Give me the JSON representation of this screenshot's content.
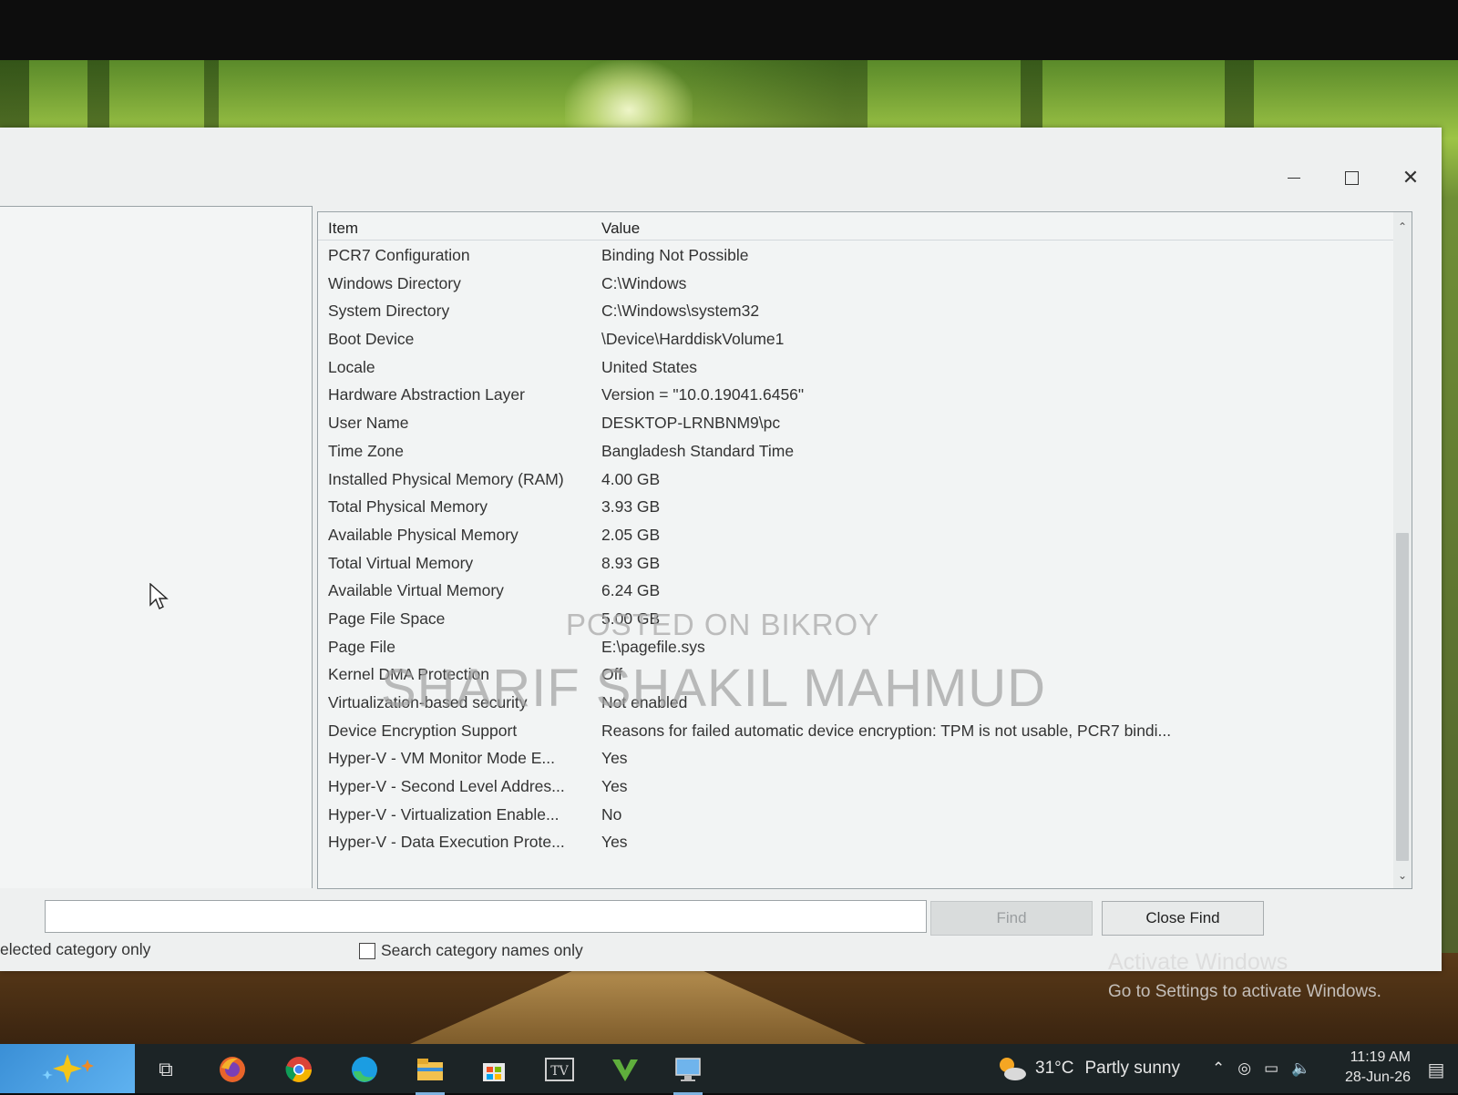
{
  "window": {
    "controls": {
      "minimize_icon": "minimize-icon",
      "maximize_icon": "maximize-icon",
      "close_icon": "close-icon"
    }
  },
  "list": {
    "header": {
      "item": "Item",
      "value": "Value"
    },
    "rows": [
      {
        "item": "PCR7 Configuration",
        "value": "Binding Not Possible"
      },
      {
        "item": "Windows Directory",
        "value": "C:\\Windows"
      },
      {
        "item": "System Directory",
        "value": "C:\\Windows\\system32"
      },
      {
        "item": "Boot Device",
        "value": "\\Device\\HarddiskVolume1"
      },
      {
        "item": "Locale",
        "value": "United States"
      },
      {
        "item": "Hardware Abstraction Layer",
        "value": "Version = \"10.0.19041.6456\""
      },
      {
        "item": "User Name",
        "value": "DESKTOP-LRNBNM9\\pc"
      },
      {
        "item": "Time Zone",
        "value": "Bangladesh Standard Time"
      },
      {
        "item": "Installed Physical Memory (RAM)",
        "value": "4.00 GB"
      },
      {
        "item": "Total Physical Memory",
        "value": "3.93 GB"
      },
      {
        "item": "Available Physical Memory",
        "value": "2.05 GB"
      },
      {
        "item": "Total Virtual Memory",
        "value": "8.93 GB"
      },
      {
        "item": "Available Virtual Memory",
        "value": "6.24 GB"
      },
      {
        "item": "Page File Space",
        "value": "5.00 GB"
      },
      {
        "item": "Page File",
        "value": "E:\\pagefile.sys"
      },
      {
        "item": "Kernel DMA Protection",
        "value": "Off"
      },
      {
        "item": "Virtualization-based security",
        "value": "Not enabled"
      },
      {
        "item": "Device Encryption Support",
        "value": "Reasons for failed automatic device encryption: TPM is not usable, PCR7 bindi..."
      },
      {
        "item": "Hyper-V - VM Monitor Mode E...",
        "value": "Yes"
      },
      {
        "item": "Hyper-V - Second Level Addres...",
        "value": "Yes"
      },
      {
        "item": "Hyper-V - Virtualization Enable...",
        "value": "No"
      },
      {
        "item": "Hyper-V - Data Execution Prote...",
        "value": "Yes"
      }
    ]
  },
  "find": {
    "input_value": "",
    "find_label": "Find",
    "close_find_label": "Close Find",
    "selected_category_label": "elected category only",
    "search_names_label": "Search category names only",
    "search_names_checked": false
  },
  "watermarks": {
    "posted": "POSTED ON BIKROY",
    "name": "SHARIF SHAKIL MAHMUD"
  },
  "activation": {
    "title": "Activate Windows",
    "subtitle": "Go to Settings to activate Windows."
  },
  "taskbar": {
    "apps": [
      "task-view-icon",
      "firefox-icon",
      "chrome-icon",
      "edge-icon",
      "file-explorer-icon",
      "store-icon",
      "tv-app-icon",
      "vivaldi-icon",
      "system-info-icon"
    ],
    "weather": {
      "temp": "31°C",
      "condition": "Partly sunny"
    },
    "clock": {
      "time": "11:19 AM",
      "date": "28-Jun-26"
    }
  },
  "colors": {
    "window_bg": "#eef0f0",
    "taskbar_bg": "#1c2426",
    "accent": "#3a8fd6"
  }
}
